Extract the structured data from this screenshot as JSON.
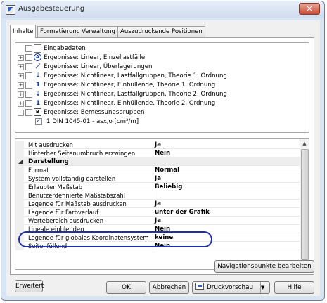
{
  "window": {
    "title": "Ausgabesteuerung",
    "close_label": "✕"
  },
  "tabs": [
    {
      "label": "Inhalte"
    },
    {
      "label": "Formatierung"
    },
    {
      "label": "Verwaltung"
    },
    {
      "label": "Auszudruckende Positionen"
    }
  ],
  "tree": {
    "items": [
      {
        "label": "Eingabedaten",
        "icon": "document-icon",
        "expander": "",
        "checked": false
      },
      {
        "label": "Ergebnisse: Linear, Einzellastfälle",
        "icon": "circled-a-icon",
        "expander": "+",
        "checked": false
      },
      {
        "label": "Ergebnisse: Linear, Überlagerungen",
        "icon": "diagonal-line-icon",
        "expander": "+",
        "checked": false
      },
      {
        "label": "Ergebnisse: Nichtlinear, Lastfallgruppen, Theorie 1. Ordnung",
        "icon": "arrows-icon",
        "expander": "+",
        "checked": false
      },
      {
        "label": "Ergebnisse: Nichtlinear, Einhüllende, Theorie 1. Ordnung",
        "icon": "order-1-icon",
        "expander": "+",
        "checked": false
      },
      {
        "label": "Ergebnisse: Nichtlinear, Lastfallgruppen, Theorie 2. Ordnung",
        "icon": "arrows-icon",
        "expander": "+",
        "checked": false
      },
      {
        "label": "Ergebnisse: Nichtlinear, Einhüllende, Theorie 2. Ordnung",
        "icon": "order-2-icon",
        "expander": "+",
        "checked": false
      },
      {
        "label": "Ergebnisse: Bemessungsgruppen",
        "icon": "boxed-b-icon",
        "expander": "-",
        "checked": false
      },
      {
        "label": "1  DIN 1045-01 - asx,o [cm²/m]",
        "icon": "",
        "expander": "",
        "checked": true
      }
    ]
  },
  "properties": {
    "rows": [
      {
        "type": "row",
        "key": "Mit ausdrucken",
        "value": "Ja"
      },
      {
        "type": "row",
        "key": "Hinterher Seitenumbruch erzwingen",
        "value": "Nein"
      },
      {
        "type": "group",
        "key": "Darstellung",
        "value": ""
      },
      {
        "type": "row",
        "key": "Format",
        "value": "Normal"
      },
      {
        "type": "row",
        "key": "System vollständig darstellen",
        "value": "Ja"
      },
      {
        "type": "row",
        "key": "Erlaubter Maßstab",
        "value": "Beliebig"
      },
      {
        "type": "row",
        "key": "Benutzerdefinierte Maßstabszahl",
        "value": ""
      },
      {
        "type": "row",
        "key": "Legende für Maßstab ausdrucken",
        "value": "Ja"
      },
      {
        "type": "row",
        "key": "Legende für Farbverlauf",
        "value": "unter der Grafik"
      },
      {
        "type": "row",
        "key": "Wertebereich ausdrucken",
        "value": "Ja"
      },
      {
        "type": "row",
        "key": "Lineale einblenden",
        "value": "Nein"
      },
      {
        "type": "row",
        "key": "Legende für globales Koordinatensystem",
        "value": "keine"
      },
      {
        "type": "row",
        "key": "Seitenfüllend",
        "value": "Nein"
      }
    ]
  },
  "buttons": {
    "erweitert": "Erweitert",
    "navigationspunkte": "Navigationspunkte bearbeiten",
    "ok": "OK",
    "abbrechen": "Abbrechen",
    "druckvorschau": "Druckvorschau",
    "hilfe": "Hilfe"
  },
  "colors": {
    "highlight_ellipse": "#1e2fa8",
    "window_frame": "#d9e4f2"
  }
}
